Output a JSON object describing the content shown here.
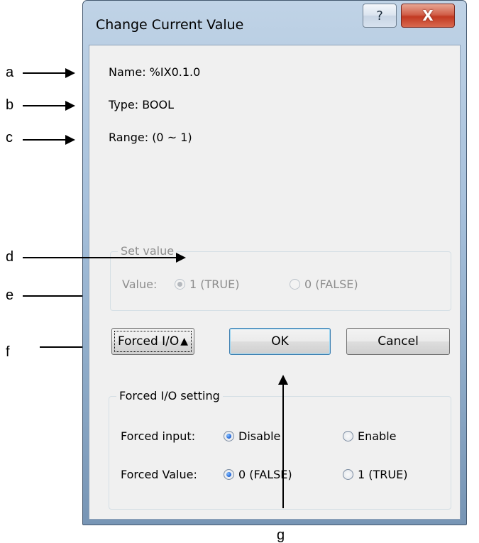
{
  "window": {
    "title": "Change Current Value",
    "help_glyph": "?",
    "close_glyph": "X"
  },
  "info": {
    "name": "Name:  %IX0.1.0",
    "type": "Type:  BOOL",
    "range": "Range: (0 ~ 1)"
  },
  "set_value": {
    "group_label": "Set value",
    "value_label": "Value:",
    "option_true": "1 (TRUE)",
    "option_false": "0 (FALSE)",
    "selected": "1 (TRUE)",
    "enabled": false
  },
  "buttons": {
    "forced_io": "Forced I/O",
    "ok": "OK",
    "cancel": "Cancel"
  },
  "forced_io_setting": {
    "group_label": "Forced I/O setting",
    "input_label": "Forced input:",
    "input_disable": "Disable",
    "input_enable": "Enable",
    "input_selected": "Disable",
    "value_label": "Forced Value:",
    "value_false": "0 (FALSE)",
    "value_true": "1 (TRUE)",
    "value_selected": "0 (FALSE)"
  },
  "annotations": [
    "a",
    "b",
    "c",
    "d",
    "e",
    "f",
    "g"
  ],
  "colors": {
    "close_button": "#c8432c",
    "frame": "#a6c0db",
    "client": "#f0f0f0",
    "disabled_text": "#8d8d8d"
  }
}
